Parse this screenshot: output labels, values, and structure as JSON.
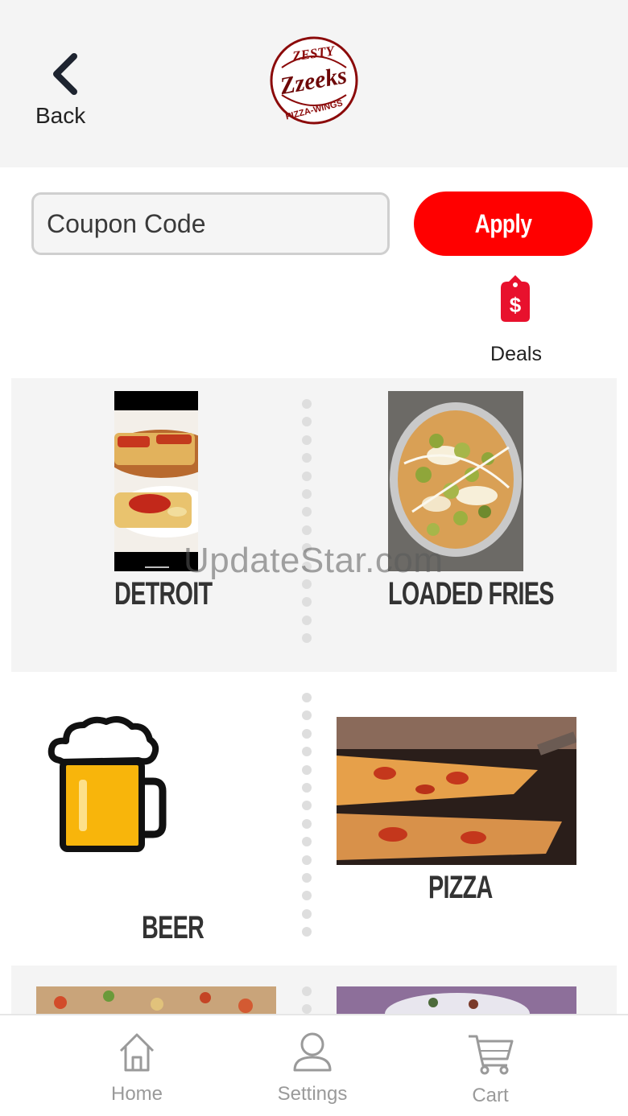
{
  "header": {
    "back_label": "Back",
    "logo": {
      "top_text": "ZESTY",
      "main_text": "Zzeeks",
      "bottom_text": "PIZZA-WINGS",
      "color": "#8b0a0a"
    }
  },
  "coupon": {
    "placeholder": "Coupon Code",
    "value": "",
    "apply_label": "Apply",
    "apply_color": "#ff0000"
  },
  "deals": {
    "label": "Deals",
    "icon": "price-tag-dollar-icon",
    "color": "#e8112d"
  },
  "categories": [
    {
      "label": "DETROIT",
      "image": "detroit-pizza-photo"
    },
    {
      "label": "LOADED FRIES",
      "image": "loaded-fries-photo"
    },
    {
      "label": "BEER",
      "image": "beer-mug-illustration"
    },
    {
      "label": "PIZZA",
      "image": "pizza-slice-photo"
    },
    {
      "label": "",
      "image": "pizza-topping-photo"
    },
    {
      "label": "",
      "image": "food-plate-photo"
    }
  ],
  "watermark": "UpdateStar.com",
  "nav": {
    "items": [
      {
        "label": "Home",
        "icon": "home-icon"
      },
      {
        "label": "Settings",
        "icon": "user-icon"
      },
      {
        "label": "Cart",
        "icon": "cart-icon"
      }
    ]
  }
}
